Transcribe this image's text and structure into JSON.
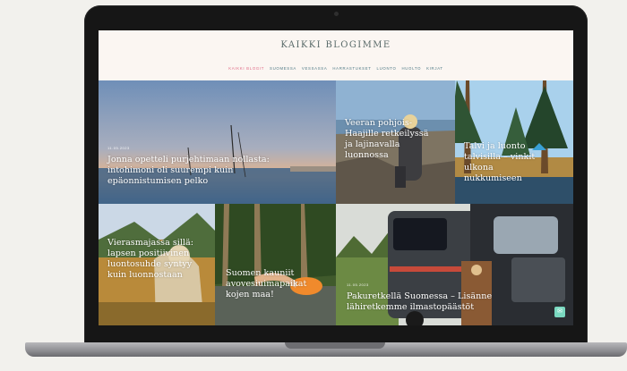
{
  "site": {
    "title": "KAIKKI BLOGIMME"
  },
  "nav": {
    "items": [
      {
        "label": "KAIKKI BLOGIT",
        "active": true
      },
      {
        "label": "SUOMESSA",
        "active": false
      },
      {
        "label": "VESSASSA",
        "active": false
      },
      {
        "label": "HARRASTUKSET",
        "active": false
      },
      {
        "label": "LUONTO",
        "active": false
      },
      {
        "label": "HUOLTO",
        "active": false
      },
      {
        "label": "KIRJAT",
        "active": false
      }
    ]
  },
  "posts": [
    {
      "date": "11.05.2023",
      "title": "Jonna opetteli purjehtimaan nollasta: intohimoni oli suurempi kuin epäonnistumisen pelko"
    },
    {
      "title": "Veeran pohjois-Haajille retkeilyssä ja lajinavalla luonnossa"
    },
    {
      "title": "Talvi ja luonto talvisilla – vinkit ulkona nukkumiseen"
    },
    {
      "title": "Vierasmajassa sillä: lapsen positiivinen luontosuhde syntyy kuin luonnostaan"
    },
    {
      "title": "Suomen kauniit avovesiuimapaikat kojen maa!"
    },
    {
      "date": "11.05.2023",
      "title": "Pakuretkellä Suomessa – Lisänne lähiretkemme ilmastopäästöt"
    }
  ],
  "colors": {
    "accent": "#e06a86",
    "nav": "#4f7a86",
    "title": "#5a6b6a",
    "background": "#faf5f1"
  },
  "icons": [
    "camera-icon",
    "chat-icon"
  ]
}
